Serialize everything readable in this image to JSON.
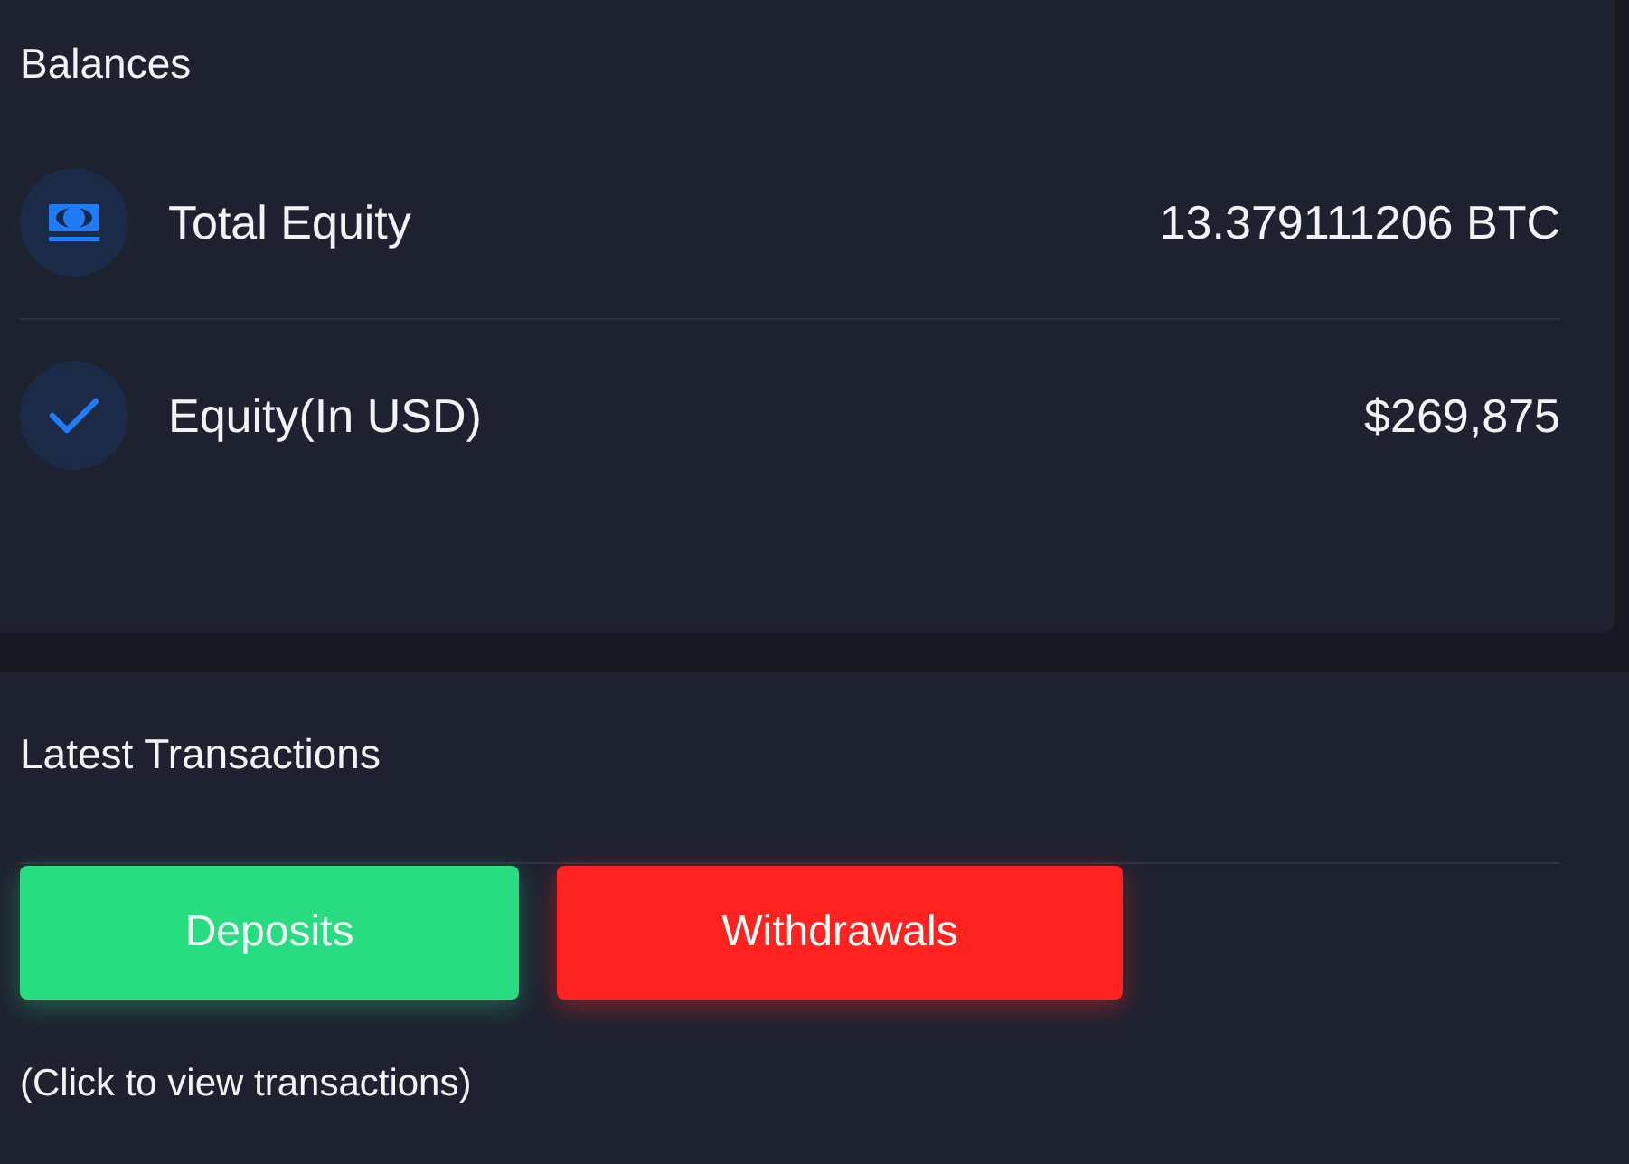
{
  "balances": {
    "title": "Balances",
    "items": [
      {
        "kind": "cash",
        "label": "Total Equity",
        "value": "13.379111206 BTC"
      },
      {
        "kind": "check",
        "label": "Equity(In USD)",
        "value": "$269,875"
      }
    ]
  },
  "latest_transactions": {
    "title": "Latest Transactions",
    "buttons": [
      {
        "kind": "deposit",
        "label": "Deposits"
      },
      {
        "kind": "withdrawal",
        "label": "Withdrawals"
      }
    ],
    "hint": "(Click to view transactions)"
  }
}
